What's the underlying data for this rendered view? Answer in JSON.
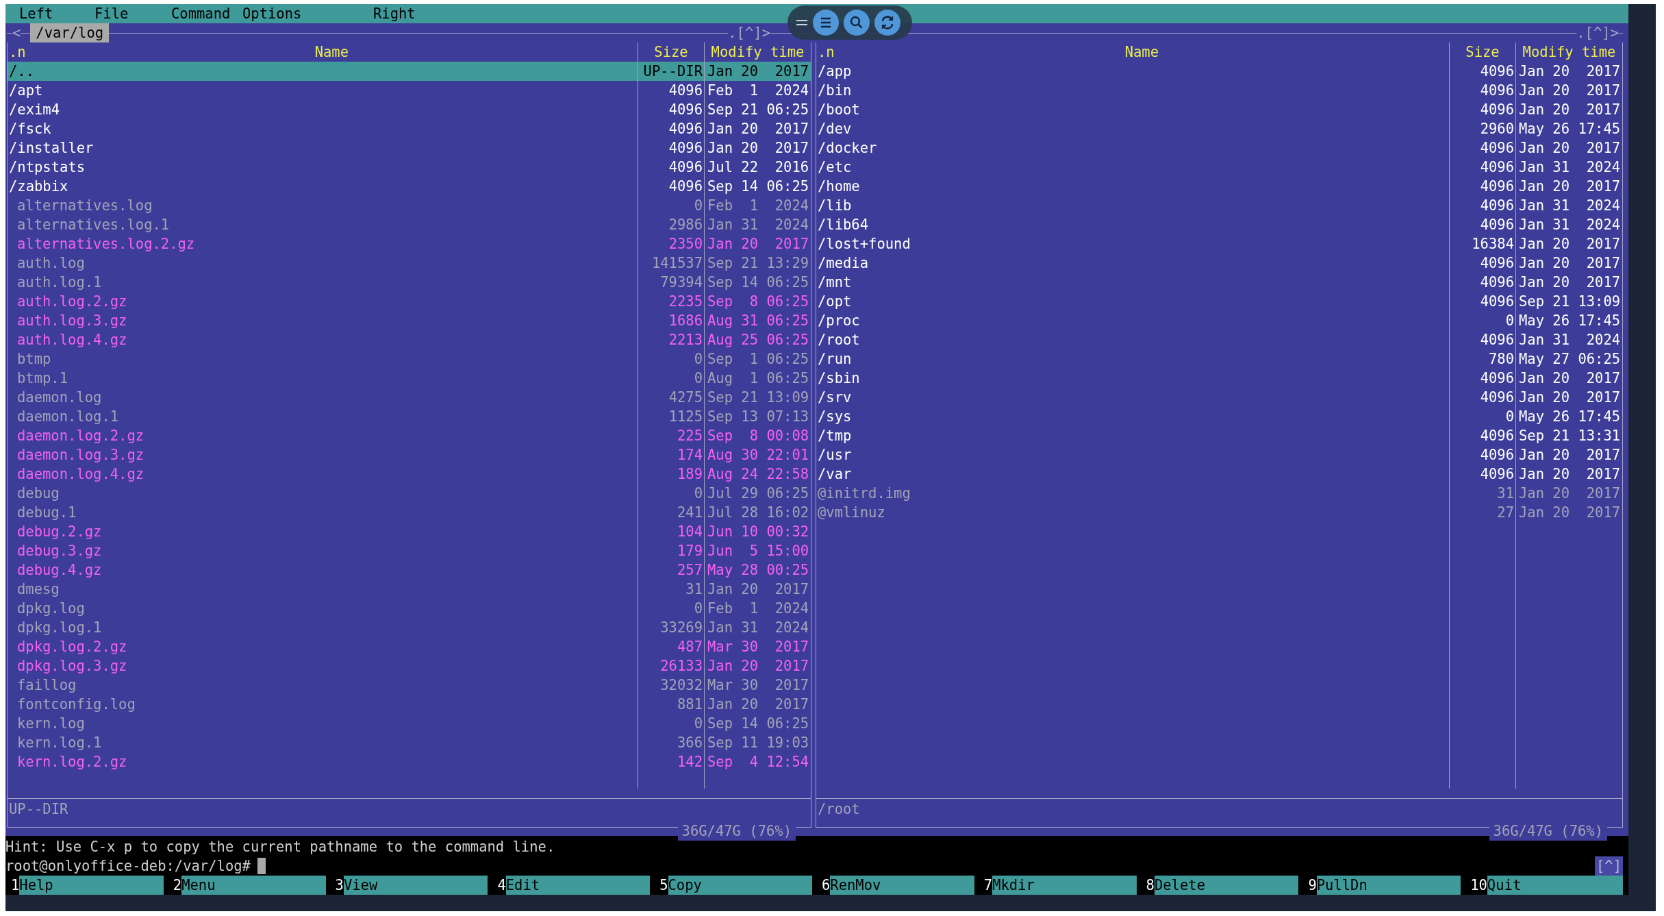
{
  "menu_bar": {
    "items": [
      "Left",
      "File",
      "Command",
      "Options",
      "Right"
    ]
  },
  "panels": [
    {
      "top_left_marker": "<",
      "path": "/var/log",
      "top_right_marker": ".[^]>",
      "columns": [
        ".n",
        "Name",
        "Size",
        "Modify time"
      ],
      "rows": [
        {
          "name": "/..",
          "size": "UP--DIR",
          "modified": "Jan 20  2017",
          "kind": "updir",
          "selected": true
        },
        {
          "name": "/apt",
          "size": "4096",
          "modified": "Feb  1  2024",
          "kind": "dir",
          "selected": false
        },
        {
          "name": "/exim4",
          "size": "4096",
          "modified": "Sep 21 06:25",
          "kind": "dir",
          "selected": false
        },
        {
          "name": "/fsck",
          "size": "4096",
          "modified": "Jan 20  2017",
          "kind": "dir",
          "selected": false
        },
        {
          "name": "/installer",
          "size": "4096",
          "modified": "Jan 20  2017",
          "kind": "dir",
          "selected": false
        },
        {
          "name": "/ntpstats",
          "size": "4096",
          "modified": "Jul 22  2016",
          "kind": "dir",
          "selected": false
        },
        {
          "name": "/zabbix",
          "size": "4096",
          "modified": "Sep 14 06:25",
          "kind": "dir",
          "selected": false
        },
        {
          "name": "alternatives.log",
          "size": "0",
          "modified": "Feb  1  2024",
          "kind": "file",
          "selected": false
        },
        {
          "name": "alternatives.log.1",
          "size": "2986",
          "modified": "Jan 31  2024",
          "kind": "file",
          "selected": false
        },
        {
          "name": "alternatives.log.2.gz",
          "size": "2350",
          "modified": "Jan 20  2017",
          "kind": "archive",
          "selected": false
        },
        {
          "name": "auth.log",
          "size": "141537",
          "modified": "Sep 21 13:29",
          "kind": "file",
          "selected": false
        },
        {
          "name": "auth.log.1",
          "size": "79394",
          "modified": "Sep 14 06:25",
          "kind": "file",
          "selected": false
        },
        {
          "name": "auth.log.2.gz",
          "size": "2235",
          "modified": "Sep  8 06:25",
          "kind": "archive",
          "selected": false
        },
        {
          "name": "auth.log.3.gz",
          "size": "1686",
          "modified": "Aug 31 06:25",
          "kind": "archive",
          "selected": false
        },
        {
          "name": "auth.log.4.gz",
          "size": "2213",
          "modified": "Aug 25 06:25",
          "kind": "archive",
          "selected": false
        },
        {
          "name": "btmp",
          "size": "0",
          "modified": "Sep  1 06:25",
          "kind": "file",
          "selected": false
        },
        {
          "name": "btmp.1",
          "size": "0",
          "modified": "Aug  1 06:25",
          "kind": "file",
          "selected": false
        },
        {
          "name": "daemon.log",
          "size": "4275",
          "modified": "Sep 21 13:09",
          "kind": "file",
          "selected": false
        },
        {
          "name": "daemon.log.1",
          "size": "1125",
          "modified": "Sep 13 07:13",
          "kind": "file",
          "selected": false
        },
        {
          "name": "daemon.log.2.gz",
          "size": "225",
          "modified": "Sep  8 00:08",
          "kind": "archive",
          "selected": false
        },
        {
          "name": "daemon.log.3.gz",
          "size": "174",
          "modified": "Aug 30 22:01",
          "kind": "archive",
          "selected": false
        },
        {
          "name": "daemon.log.4.gz",
          "size": "189",
          "modified": "Aug 24 22:58",
          "kind": "archive",
          "selected": false
        },
        {
          "name": "debug",
          "size": "0",
          "modified": "Jul 29 06:25",
          "kind": "file",
          "selected": false
        },
        {
          "name": "debug.1",
          "size": "241",
          "modified": "Jul 28 16:02",
          "kind": "file",
          "selected": false
        },
        {
          "name": "debug.2.gz",
          "size": "104",
          "modified": "Jun 10 00:32",
          "kind": "archive",
          "selected": false
        },
        {
          "name": "debug.3.gz",
          "size": "179",
          "modified": "Jun  5 15:00",
          "kind": "archive",
          "selected": false
        },
        {
          "name": "debug.4.gz",
          "size": "257",
          "modified": "May 28 00:25",
          "kind": "archive",
          "selected": false
        },
        {
          "name": "dmesg",
          "size": "31",
          "modified": "Jan 20  2017",
          "kind": "file",
          "selected": false
        },
        {
          "name": "dpkg.log",
          "size": "0",
          "modified": "Feb  1  2024",
          "kind": "file",
          "selected": false
        },
        {
          "name": "dpkg.log.1",
          "size": "33269",
          "modified": "Jan 31  2024",
          "kind": "file",
          "selected": false
        },
        {
          "name": "dpkg.log.2.gz",
          "size": "487",
          "modified": "Mar 30  2017",
          "kind": "archive",
          "selected": false
        },
        {
          "name": "dpkg.log.3.gz",
          "size": "26133",
          "modified": "Jan 20  2017",
          "kind": "archive",
          "selected": false
        },
        {
          "name": "faillog",
          "size": "32032",
          "modified": "Mar 30  2017",
          "kind": "file",
          "selected": false
        },
        {
          "name": "fontconfig.log",
          "size": "881",
          "modified": "Jan 20  2017",
          "kind": "file",
          "selected": false
        },
        {
          "name": "kern.log",
          "size": "0",
          "modified": "Sep 14 06:25",
          "kind": "file",
          "selected": false
        },
        {
          "name": "kern.log.1",
          "size": "366",
          "modified": "Sep 11 19:03",
          "kind": "file",
          "selected": false
        },
        {
          "name": "kern.log.2.gz",
          "size": "142",
          "modified": "Sep  4 12:54",
          "kind": "archive",
          "selected": false
        }
      ],
      "status": "UP--DIR",
      "disk": "36G/47G (76%)"
    },
    {
      "top_right_marker": ".[^]>",
      "columns": [
        ".n",
        "Name",
        "Size",
        "Modify time"
      ],
      "rows": [
        {
          "name": "/app",
          "size": "4096",
          "modified": "Jan 20  2017",
          "kind": "dir",
          "selected": false
        },
        {
          "name": "/bin",
          "size": "4096",
          "modified": "Jan 20  2017",
          "kind": "dir",
          "selected": false
        },
        {
          "name": "/boot",
          "size": "4096",
          "modified": "Jan 20  2017",
          "kind": "dir",
          "selected": false
        },
        {
          "name": "/dev",
          "size": "2960",
          "modified": "May 26 17:45",
          "kind": "dir",
          "selected": false
        },
        {
          "name": "/docker",
          "size": "4096",
          "modified": "Jan 20  2017",
          "kind": "dir",
          "selected": false
        },
        {
          "name": "/etc",
          "size": "4096",
          "modified": "Jan 31  2024",
          "kind": "dir",
          "selected": false
        },
        {
          "name": "/home",
          "size": "4096",
          "modified": "Jan 20  2017",
          "kind": "dir",
          "selected": false
        },
        {
          "name": "/lib",
          "size": "4096",
          "modified": "Jan 31  2024",
          "kind": "dir",
          "selected": false
        },
        {
          "name": "/lib64",
          "size": "4096",
          "modified": "Jan 31  2024",
          "kind": "dir",
          "selected": false
        },
        {
          "name": "/lost+found",
          "size": "16384",
          "modified": "Jan 20  2017",
          "kind": "dir",
          "selected": false
        },
        {
          "name": "/media",
          "size": "4096",
          "modified": "Jan 20  2017",
          "kind": "dir",
          "selected": false
        },
        {
          "name": "/mnt",
          "size": "4096",
          "modified": "Jan 20  2017",
          "kind": "dir",
          "selected": false
        },
        {
          "name": "/opt",
          "size": "4096",
          "modified": "Sep 21 13:09",
          "kind": "dir",
          "selected": false
        },
        {
          "name": "/proc",
          "size": "0",
          "modified": "May 26 17:45",
          "kind": "dir",
          "selected": false
        },
        {
          "name": "/root",
          "size": "4096",
          "modified": "Jan 31  2024",
          "kind": "dir",
          "selected": false
        },
        {
          "name": "/run",
          "size": "780",
          "modified": "May 27 06:25",
          "kind": "dir",
          "selected": false
        },
        {
          "name": "/sbin",
          "size": "4096",
          "modified": "Jan 20  2017",
          "kind": "dir",
          "selected": false
        },
        {
          "name": "/srv",
          "size": "4096",
          "modified": "Jan 20  2017",
          "kind": "dir",
          "selected": false
        },
        {
          "name": "/sys",
          "size": "0",
          "modified": "May 26 17:45",
          "kind": "dir",
          "selected": false
        },
        {
          "name": "/tmp",
          "size": "4096",
          "modified": "Sep 21 13:31",
          "kind": "dir",
          "selected": false
        },
        {
          "name": "/usr",
          "size": "4096",
          "modified": "Jan 20  2017",
          "kind": "dir",
          "selected": false
        },
        {
          "name": "/var",
          "size": "4096",
          "modified": "Jan 20  2017",
          "kind": "dir",
          "selected": false
        },
        {
          "name": "@initrd.img",
          "size": "31",
          "modified": "Jan 20  2017",
          "kind": "symlink",
          "selected": false
        },
        {
          "name": "@vmlinuz",
          "size": "27",
          "modified": "Jan 20  2017",
          "kind": "symlink",
          "selected": false
        }
      ],
      "status": "/root",
      "disk": "36G/47G (76%)"
    }
  ],
  "hint": "Hint: Use C-x p to copy the current pathname to the command line.",
  "prompt": "root@onlyoffice-deb:/var/log#",
  "scroll_indicator": "[^]",
  "function_keys": [
    {
      "number": "1",
      "label": "Help"
    },
    {
      "number": "2",
      "label": "Menu"
    },
    {
      "number": "3",
      "label": "View"
    },
    {
      "number": "4",
      "label": "Edit"
    },
    {
      "number": "5",
      "label": "Copy"
    },
    {
      "number": "6",
      "label": "RenMov"
    },
    {
      "number": "7",
      "label": "Mkdir"
    },
    {
      "number": "8",
      "label": "Delete"
    },
    {
      "number": "9",
      "label": "PullDn"
    },
    {
      "number": "10",
      "label": "Quit"
    }
  ]
}
